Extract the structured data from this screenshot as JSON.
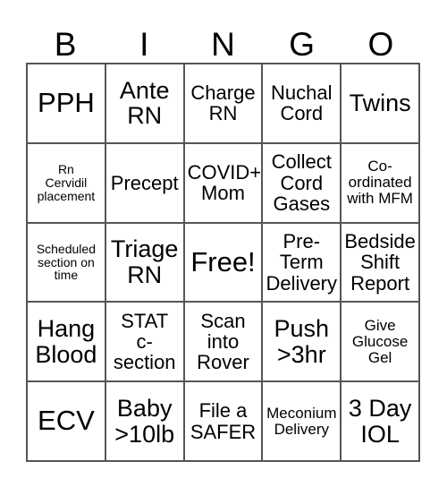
{
  "card": {
    "title_letters": [
      "B",
      "I",
      "N",
      "G",
      "O"
    ],
    "columns": 5,
    "rows": 5,
    "border_color": "#555555",
    "background_color": "#ffffff",
    "text_color": "#000000",
    "cells": [
      {
        "text": "PPH",
        "size": "xl",
        "free": false
      },
      {
        "text": "Ante\nRN",
        "size": "lg",
        "free": false
      },
      {
        "text": "Charge\nRN",
        "size": "md",
        "free": false
      },
      {
        "text": "Nuchal\nCord",
        "size": "md",
        "free": false
      },
      {
        "text": "Twins",
        "size": "lg",
        "free": false
      },
      {
        "text": "Rn\nCervidil\nplacement",
        "size": "xs",
        "free": false
      },
      {
        "text": "Precept",
        "size": "md",
        "free": false
      },
      {
        "text": "COVID+\nMom",
        "size": "md",
        "free": false
      },
      {
        "text": "Collect\nCord\nGases",
        "size": "md",
        "free": false
      },
      {
        "text": "Co-\nordinated\nwith MFM",
        "size": "sm",
        "free": false
      },
      {
        "text": "Scheduled\nsection on\ntime",
        "size": "xs",
        "free": false
      },
      {
        "text": "Triage\nRN",
        "size": "lg",
        "free": false
      },
      {
        "text": "Free!",
        "size": "xl",
        "free": true
      },
      {
        "text": "Pre-\nTerm\nDelivery",
        "size": "md",
        "free": false
      },
      {
        "text": "Bedside\nShift\nReport",
        "size": "md",
        "free": false
      },
      {
        "text": "Hang\nBlood",
        "size": "lg",
        "free": false
      },
      {
        "text": "STAT\nc-\nsection",
        "size": "md",
        "free": false
      },
      {
        "text": "Scan\ninto\nRover",
        "size": "md",
        "free": false
      },
      {
        "text": "Push\n>3hr",
        "size": "lg",
        "free": false
      },
      {
        "text": "Give\nGlucose\nGel",
        "size": "sm",
        "free": false
      },
      {
        "text": "ECV",
        "size": "xl",
        "free": false
      },
      {
        "text": "Baby\n>10lb",
        "size": "lg",
        "free": false
      },
      {
        "text": "File a\nSAFER",
        "size": "md",
        "free": false
      },
      {
        "text": "Meconium\nDelivery",
        "size": "sm",
        "free": false
      },
      {
        "text": "3 Day\nIOL",
        "size": "lg",
        "free": false
      }
    ]
  }
}
